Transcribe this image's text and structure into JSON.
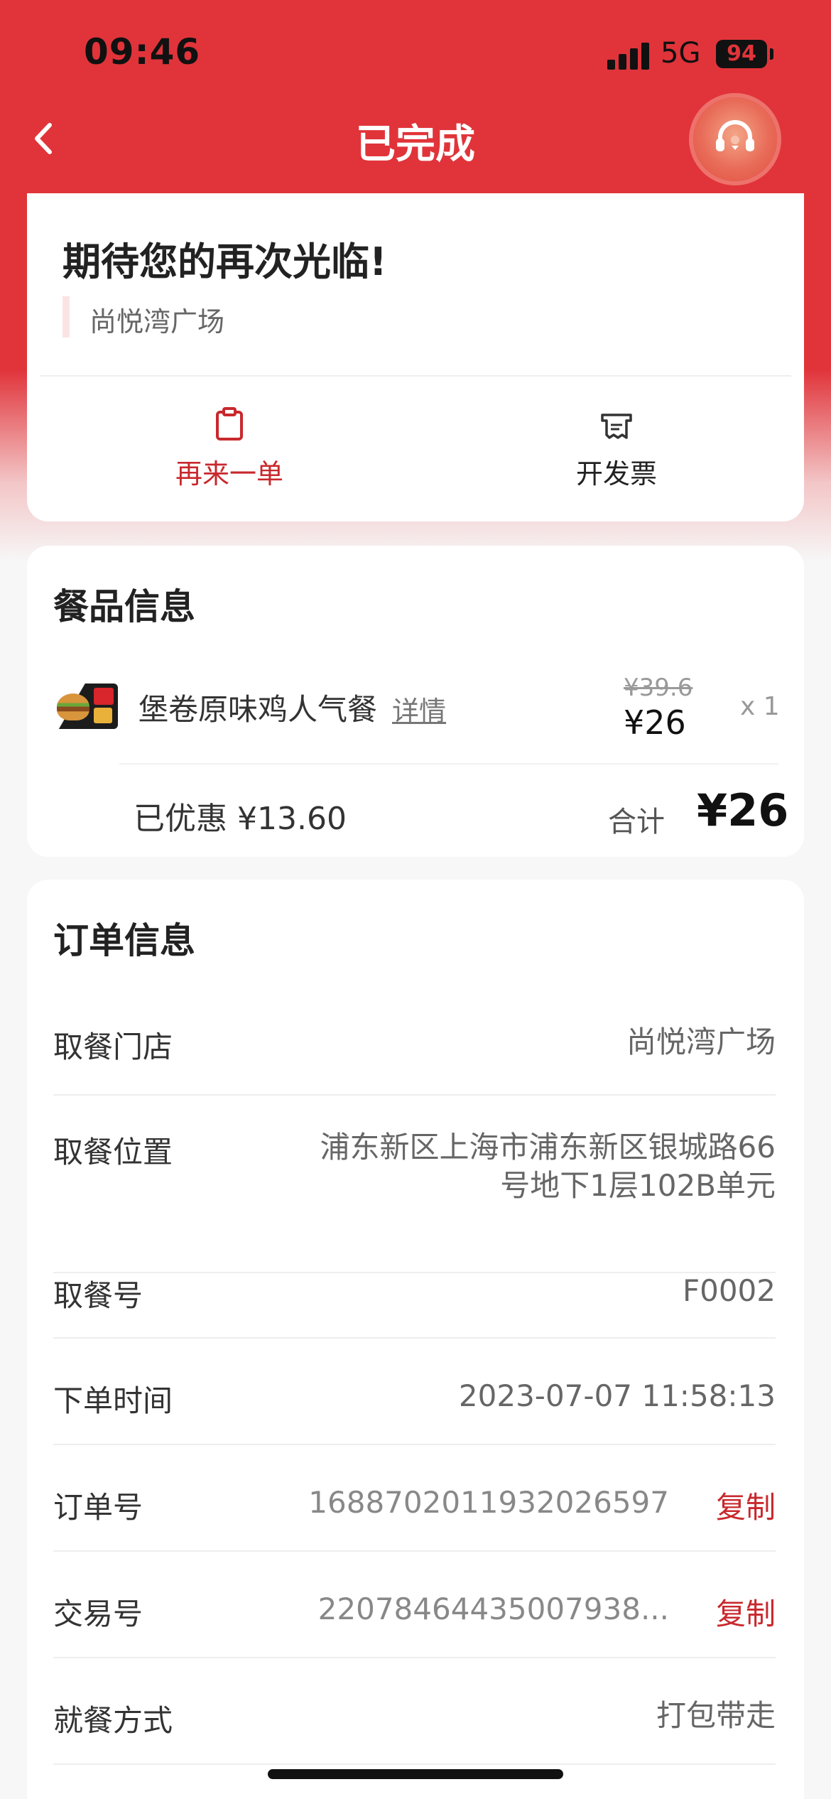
{
  "status_bar": {
    "time": "09:46",
    "network": "5G",
    "battery": "94"
  },
  "header": {
    "title": "已完成",
    "back_icon": "chevron-left-icon",
    "service_icon": "headset-icon",
    "accent_color": "#e0343a"
  },
  "summary": {
    "title": "期待您的再次光临!",
    "store": "尚悦湾广场",
    "actions": [
      {
        "label": "再来一单",
        "icon": "clipboard-icon",
        "color": "#c8282d"
      },
      {
        "label": "开发票",
        "icon": "receipt-icon",
        "color": "#222222"
      }
    ]
  },
  "meal_info": {
    "title": "餐品信息",
    "items": [
      {
        "name": "堡卷原味鸡人气餐",
        "detail_label": "详情",
        "original_price": "¥39.6",
        "price": "¥26",
        "quantity": "x 1"
      }
    ],
    "discount": "已优惠 ¥13.60",
    "total_label": "合计",
    "total_value": "¥26"
  },
  "order_info": {
    "title": "订单信息",
    "rows": [
      {
        "label": "取餐门店",
        "value": "尚悦湾广场"
      },
      {
        "label": "取餐位置",
        "value_line1": "浦东新区上海市浦东新区银城路66",
        "value_line2": "号地下1层102B单元"
      },
      {
        "label": "取餐号",
        "value": "F0002"
      },
      {
        "label": "下单时间",
        "value": "2023-07-07 11:58:13"
      },
      {
        "label": "订单号",
        "value": "1688702011932026597",
        "action": "复制"
      },
      {
        "label": "交易号",
        "value": "22078464435007938...",
        "action": "复制"
      },
      {
        "label": "就餐方式",
        "value": "打包带走"
      }
    ]
  }
}
